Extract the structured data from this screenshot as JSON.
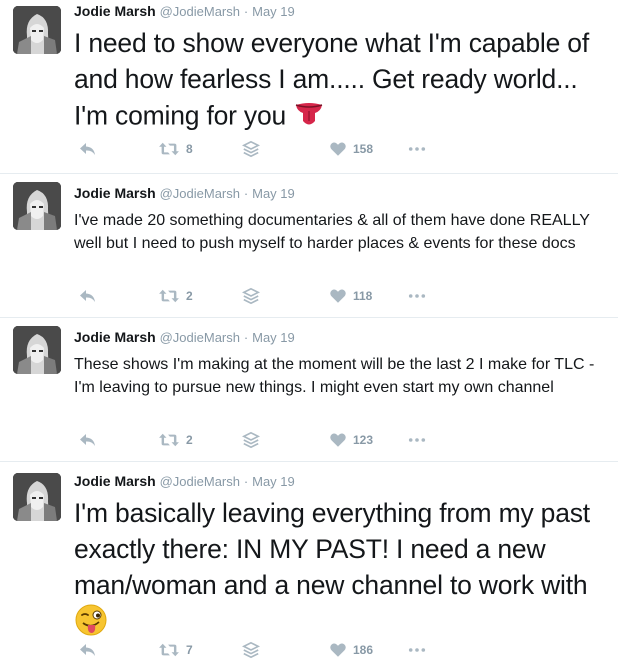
{
  "tweets": [
    {
      "name": "Jodie Marsh",
      "handle": "@JodieMarsh",
      "sep": "·",
      "date": "May 19",
      "text": "I need to show everyone what I'm capable of and how fearless I am..... Get ready world... I'm coming for you",
      "emoji": "tongue-out-emoji",
      "retweets": "8",
      "likes": "158"
    },
    {
      "name": "Jodie Marsh",
      "handle": "@JodieMarsh",
      "sep": "·",
      "date": "May 19",
      "text": "I've made 20 something documentaries & all of them have done REALLY well but I need to push myself to harder places & events for these docs",
      "retweets": "2",
      "likes": "118"
    },
    {
      "name": "Jodie Marsh",
      "handle": "@JodieMarsh",
      "sep": "·",
      "date": "May 19",
      "text": "These shows I'm making at the moment will be the last 2 I make for TLC - I'm leaving to pursue new things. I might even start my own channel",
      "retweets": "2",
      "likes": "123"
    },
    {
      "name": "Jodie Marsh",
      "handle": "@JodieMarsh",
      "sep": "·",
      "date": "May 19",
      "text": "I'm basically leaving everything from my past exactly there: IN MY PAST! I need a new man/woman and a new channel to work with",
      "emoji": "winking-tongue-emoji",
      "retweets": "7",
      "likes": "186"
    }
  ],
  "colors": {
    "text": "#14171a",
    "muted": "#8899a6",
    "icon": "#aab8c2",
    "divider": "#e6ecf0"
  }
}
